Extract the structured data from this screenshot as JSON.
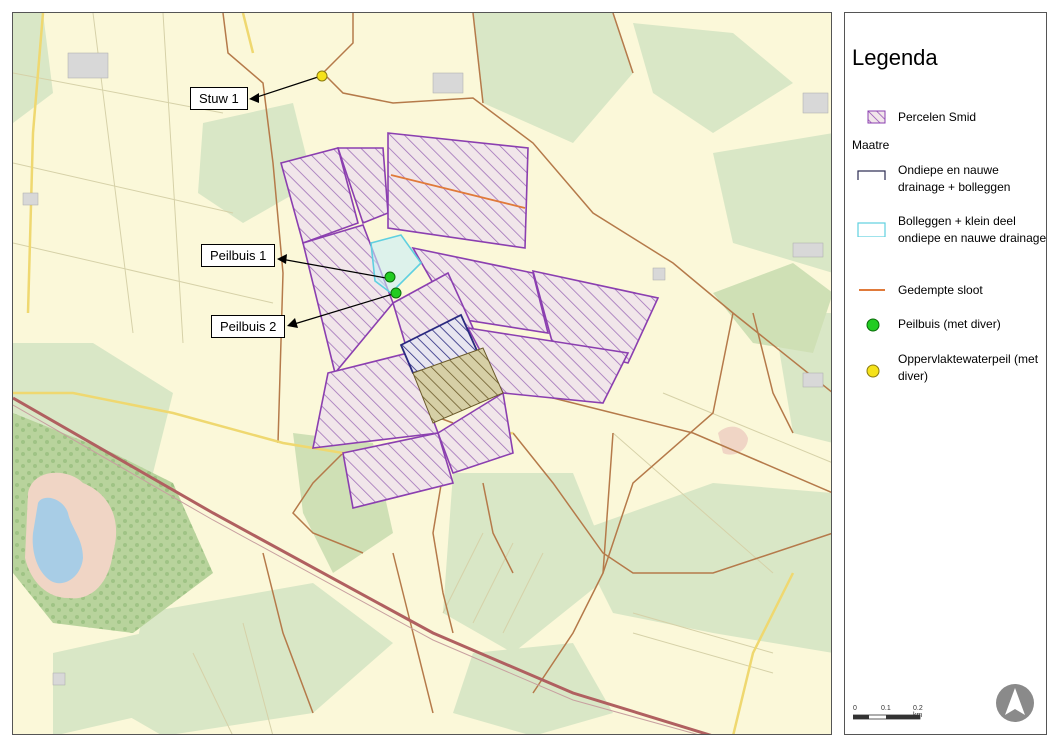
{
  "map": {
    "callouts": {
      "stuw1": "Stuw 1",
      "peilbuis1": "Peilbuis 1",
      "peilbuis2": "Peilbuis 2"
    },
    "colors": {
      "background": "#fbf8d9",
      "green_areas": "#d9e7c6",
      "forest": "#a9c98f",
      "water": "#a8cde6",
      "road": "#c96a3a",
      "parcel_outline": "#8b3fb0",
      "drainage_outline": "#2a2a80",
      "bolleggen_outline": "#5fd0e0",
      "gedempte_sloot": "#e07a3a",
      "peilbuis_fill": "#22cc22",
      "waterpeil_fill": "#f5e21a"
    }
  },
  "legend": {
    "title": "Legenda",
    "section_title": "Maatre",
    "items": [
      {
        "label": "Percelen Smid",
        "icon": "hatched-parcel-swatch"
      },
      {
        "label": "Ondiepe en nauwe drainage + bolleggen",
        "icon": "dark-blue-outline-swatch"
      },
      {
        "label": "Bolleggen + klein deel ondiepe en nauwe drainage",
        "icon": "cyan-outline-swatch"
      },
      {
        "label": "Gedempte sloot",
        "icon": "orange-line-swatch"
      },
      {
        "label": "Peilbuis (met diver)",
        "icon": "green-dot-swatch"
      },
      {
        "label": "Oppervlaktewaterpeil (met diver)",
        "icon": "yellow-dot-swatch"
      }
    ],
    "scale": {
      "labels": [
        "0",
        "0.1",
        "0.2 km"
      ]
    },
    "north_arrow_icon": "north-arrow-icon"
  }
}
